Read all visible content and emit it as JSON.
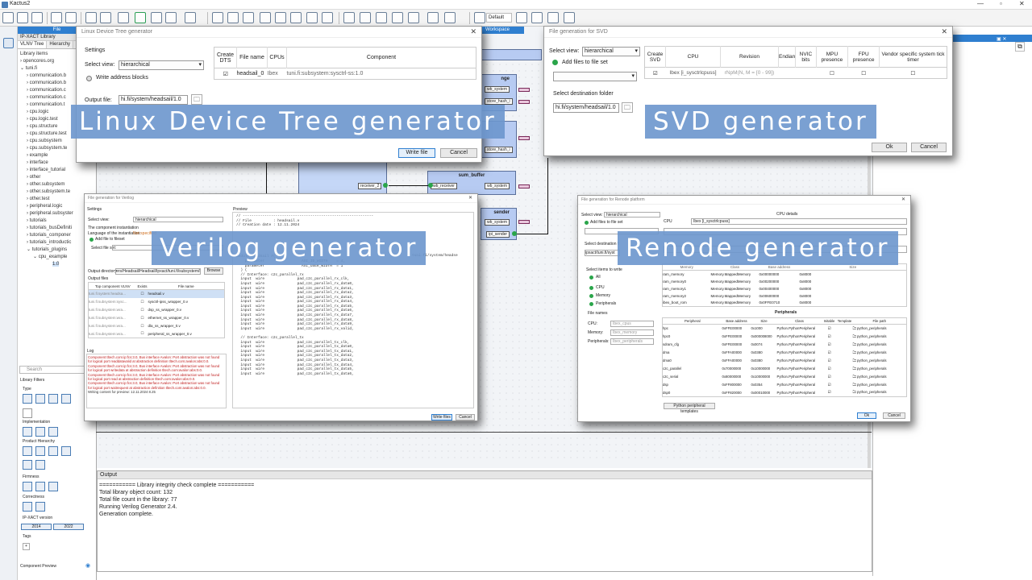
{
  "app": {
    "title": "Kactus2",
    "win_min": "—",
    "win_max": "▫",
    "win_close": "✕",
    "zoom_default": "Default"
  },
  "left": {
    "file_tab": "File",
    "library_title": "IP-XACT Library",
    "tab_vlnv": "VLNV Tree",
    "tab_hier": "Hierarchy",
    "tree_title": "Library items",
    "tree": [
      "opencores.org",
      "tuni.fi",
      "communication.b",
      "communication.b",
      "communication.c",
      "communication.c",
      "communication.t",
      "cpu.logic",
      "cpu.logic.test",
      "cpu.structure",
      "cpu.structure.test",
      "cpu.subsystem",
      "cpu.subsystem.te",
      "example",
      "interface",
      "interface_tutorial",
      "other",
      "other.subsystem",
      "other.subsystem.te",
      "other.test",
      "peripheral.logic",
      "peripheral.subsyster",
      "tutorials",
      "tutorials_busDefiniti",
      "tutorials_componer",
      "tutorials_introductic",
      "tutorials_plugins",
      "cpu_example",
      "1.0"
    ],
    "search_placeholder": "Search",
    "filters_title": "Library Filters",
    "type_label": "Type",
    "impl_label": "Implementation",
    "hier_label": "Product Hierarchy",
    "firm_label": "Firmness",
    "corr_label": "Correctness",
    "ipx_label": "IP-XACT version",
    "v2014": "2014",
    "v2022": "2022",
    "tags_label": "Tags",
    "tags_add": "+",
    "preview_label": "Component Preview"
  },
  "canvas": {
    "workspace_tab": "Workspace",
    "blocks": {
      "top1": "nge",
      "top2": "",
      "sum_buffer": "sum_buffer",
      "bottom": "sender"
    },
    "ports": {
      "wb_system": "wb_system",
      "store_hash": "store_hash_i",
      "receiver_2": "receiver_2",
      "wb_receiver": "wb_receiver",
      "wb_system2": "wb_system",
      "wb_system3": "wb_system",
      "ipi_sender": "ipi_sender"
    }
  },
  "output": {
    "title": "Output",
    "lines": [
      "=========== Library integrity check complete ===========",
      "Total library object count: 132",
      "Total file count in the library: 77",
      "Running Verilog Generator 2.4.",
      "Generation complete."
    ]
  },
  "linux": {
    "title": "Linux Device Tree generator",
    "settings": "Settings",
    "select_view_label": "Select view:",
    "select_view_value": "hierarchical",
    "write_addr": "Write address blocks",
    "output_file_label": "Output file:",
    "output_file_value": "hi.fi/system/headsail/1.0",
    "headers": [
      "Create DTS",
      "File name",
      "CPUs",
      "Component"
    ],
    "row": {
      "file": "headsail_0",
      "cpu": "Ibex",
      "comp": "tuni.fi:subsystem:sysctrl-ss:1.0"
    },
    "write_btn": "Write file",
    "cancel_btn": "Cancel",
    "caption": "Linux Device Tree generator"
  },
  "svd": {
    "title": "File generation for SVD",
    "select_view_label": "Select view:",
    "select_view_value": "hierarchical",
    "add_files": "Add files to file set",
    "dest_label": "Select destination folder",
    "dest_value": "hi.fi/system/headsail/1.0",
    "headers": [
      "Create SVD",
      "CPU",
      "Revision",
      "Endian",
      "NVIC bits",
      "MPU presence",
      "FPU presence",
      "Vendor specific system tick timer"
    ],
    "row_cpu": "Ibex [i_sysctrlcpuss]",
    "row_rev": "rNpM(N, M = [0 - 99])",
    "ok": "Ok",
    "cancel": "Cancel",
    "caption": "SVD generator"
  },
  "verilog": {
    "title": "File generation for Verilog",
    "settings": "Settings",
    "preview": "Preview",
    "select_view": "Select view:",
    "view_val": "hierarchical",
    "instantiation": "The component instantiation",
    "lang_label": "Language of the instantiation:",
    "lang_val": "Not specified",
    "add_to_fileset": "Add file to fileset",
    "select_file": "Select file set:",
    "output_dir_label": "Output directory:",
    "output_dir_val": "ers/Headsail/Headsail/Ipxact/tuni.fi/subsystem/Headsail/1.0",
    "browse": "Browse",
    "output_files": "Output files",
    "file_headers": [
      "Top component VLNV",
      "Exists",
      "File name"
    ],
    "files": [
      [
        "tuni.fi:system:headsa...",
        "headsail.v"
      ],
      [
        "tuni.fi:subsystem:sysc...",
        "sysctrl-ipss_wrapper_0.v"
      ],
      [
        "tuni.fi:subsystem:wra...",
        "dsp_ss_wrapper_0.v"
      ],
      [
        "tuni.fi:subsystem:wra...",
        "ethernet_ss_wrapper_0.v"
      ],
      [
        "tuni.fi:subsystem:wra...",
        "dla_ss_wrapper_0.v"
      ],
      [
        "tuni.fi:subsystem:wra...",
        "peripheral_ss_wrapper_0.v"
      ]
    ],
    "log": "Log",
    "log_lines": [
      "Component tltech.com:ip:fcs:3.0, Bus interface Avalon: Port abstraction was not found",
      "for logical port readdatavalid at abstraction definition tltech.com:avalon:abs:0.0.",
      "Component tltech.com:ip:fcs:3.0, Bus interface Avalon: Port abstraction was not found",
      "for logical port writedata at abstraction definition tltech.com:avalon:abs:0.0.",
      "Component tltech.com:ip:fcs:3.0, Bus interface Avalon: Port abstraction was not found",
      "for logical port read at abstraction definition tltech.com:avalon:abs:0.0.",
      "Component tltech.com:ip:fcs:3.0, Bus interface Avalon: Port abstraction was not found",
      "for logical port waitrequest at abstraction definition tltech.com:avalon:abs:0.0.",
      "Writing content for preview: 12.11.2024 8.25"
    ],
    "code": [
      "// ------------------------------------------------------------",
      "// File          : headsail.v",
      "// Creation date : 12.11.2024",
      "",
      "",
      "",
      "",
      "",
      "",
      "module headsail #(",
      "    parameter                 AXI_ID_WIDTH    = 4,",
      "    parameter                 AXI_USER_WIDTH  = 1",
      "  ) (",
      "  // Interface: c2c_parallel_rx",
      "  input  wire               pad_c2c_parallel_rx_clk,",
      "  input  wire               pad_c2c_parallel_rx_data0,",
      "  input  wire               pad_c2c_parallel_rx_data1,",
      "  input  wire               pad_c2c_parallel_rx_data2,",
      "  input  wire               pad_c2c_parallel_rx_data3,",
      "  input  wire               pad_c2c_parallel_rx_data4,",
      "  input  wire               pad_c2c_parallel_rx_data5,",
      "  input  wire               pad_c2c_parallel_rx_data6,",
      "  input  wire               pad_c2c_parallel_rx_data7,",
      "  input  wire               pad_c2c_parallel_rx_data8,",
      "  input  wire               pad_c2c_parallel_rx_data9,",
      "  input  wire               pad_c2c_parallel_rx_valid,",
      "",
      "  // Interface: c2c_parallel_tx",
      "  input  wire               pad_c2c_parallel_tx_clk,",
      "  input  wire               pad_c2c_parallel_tx_data0,",
      "  input  wire               pad_c2c_parallel_tx_data1,",
      "  input  wire               pad_c2c_parallel_tx_data2,",
      "  input  wire               pad_c2c_parallel_tx_data3,",
      "  input  wire               pad_c2c_parallel_tx_data4,",
      "  input  wire               pad_c2c_parallel_tx_data5,",
      "  input  wire               pad_c2c_parallel_tx_data6,"
    ],
    "code_side": "tuni.fi/system/headse",
    "write_btn": "Write files",
    "cancel_btn": "Cancel",
    "caption": "Verilog generator"
  },
  "renode": {
    "title": "File generation for Renode platform",
    "select_view": "Select view:",
    "view_val": "hierarchical",
    "add_files": "Add files to file set",
    "dest_label": "Select destination f",
    "dest_val": "ipxact/tuni.fi/syst",
    "cpu_details": "CPU details",
    "cpu_label": "CPU",
    "cpu_val": "Ibex [i_sysctrlcpuss]",
    "mem_headers": [
      "Memory",
      "Class",
      "Base address",
      "Size"
    ],
    "memories": [
      [
        "ram_memory",
        "Memory.MappedMemory",
        "0x00000000",
        "0x8000"
      ],
      [
        "ram_memory0",
        "Memory.MappedMemory",
        "0x00200000",
        "0x8000"
      ],
      [
        "ram_memory1",
        "Memory.MappedMemory",
        "0x00400000",
        "0x8000"
      ],
      [
        "ram_memory2",
        "Memory.MappedMemory",
        "0x00600000",
        "0x8000"
      ],
      [
        "ibex_boot_rom",
        "Memory.MappedMemory",
        "0x0FFE0710",
        "0x8000"
      ]
    ],
    "write_title": "Select items to write",
    "opt_all": "All",
    "opt_cpu": "CPU",
    "opt_mem": "Memory",
    "opt_per": "Peripherals",
    "file_names": "File names",
    "fn_cpu_label": "CPU:",
    "fn_cpu": "Ibex_cpus",
    "fn_mem_label": "Memory:",
    "fn_mem": "Ibex_memory",
    "fn_per_label": "Peripherals:",
    "fn_per": "Ibex_peripherals",
    "peripherals_title": "Peripherals",
    "per_headers": [
      "Peripheral",
      "Base address",
      "Size",
      "Class",
      "Initable",
      "Template",
      "File path"
    ],
    "peripherals": [
      [
        "hpc",
        "0xFFE00000",
        "0x1000",
        "Python.PythonPeripheral",
        "python_peripherals"
      ],
      [
        "hpc0",
        "0xFFE00000",
        "0x000008000",
        "Python.PythonPeripheral",
        "python_peripherals"
      ],
      [
        "sdram_cfg",
        "0xFFE00000",
        "0x0074",
        "Python.PythonPeripheral",
        "python_peripherals"
      ],
      [
        "dma",
        "0xFFA00000",
        "0x0380",
        "Python.PythonPeripheral",
        "python_peripherals"
      ],
      [
        "dma0",
        "0xFFA00000",
        "0x0380",
        "Python.PythonPeripheral",
        "python_peripherals"
      ],
      [
        "c2c_parallel",
        "0x70000000",
        "0x10000000",
        "Python.PythonPeripheral",
        "python_peripherals"
      ],
      [
        "c2c_serial",
        "0x80000000",
        "0x10000000",
        "Python.PythonPeripheral",
        "python_peripherals"
      ],
      [
        "dsp",
        "0xFF800000",
        "0x0354",
        "Python.PythonPeripheral",
        "python_peripherals"
      ],
      [
        "dsp0",
        "0xFF820000",
        "0x00010000",
        "Python.PythonPeripheral",
        "python_peripherals"
      ]
    ],
    "templates_btn": "Python peripheral templates",
    "ok": "Ok",
    "cancel": "Cancel",
    "caption": "Renode generator"
  }
}
